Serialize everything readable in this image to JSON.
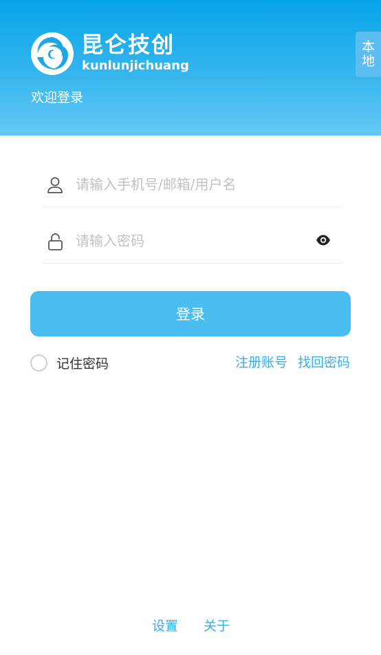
{
  "header": {
    "brand_cn": "昆仑技创",
    "brand_en": "kunlunjichuang",
    "welcome": "欢迎登录",
    "local_tab": [
      "本",
      "地"
    ]
  },
  "form": {
    "username_placeholder": "请输入手机号/邮箱/用户名",
    "username_value": "",
    "password_placeholder": "请输入密码",
    "password_value": "",
    "login_label": "登录",
    "remember_label": "记住密码",
    "remember_checked": false,
    "register_label": "注册账号",
    "forgot_label": "找回密码"
  },
  "footer": {
    "settings_label": "设置",
    "about_label": "关于"
  },
  "icons": {
    "logo": "swirl-logo-icon",
    "user": "user-icon",
    "lock": "lock-icon",
    "eye": "eye-icon"
  },
  "colors": {
    "header_top": "#08a4e8",
    "header_bottom": "#66c9f4",
    "accent": "#49bdf0",
    "link": "#3aaee8",
    "local_tab": "#5dbdf0"
  }
}
